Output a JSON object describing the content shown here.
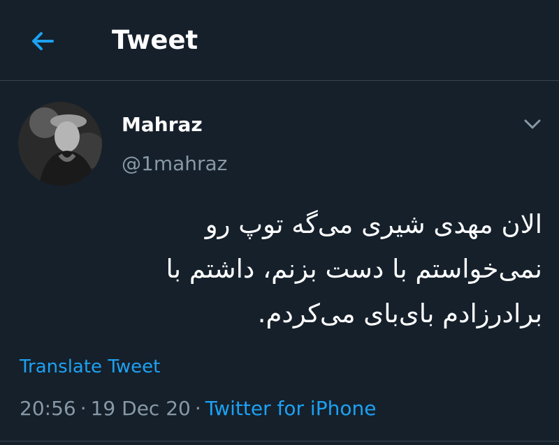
{
  "header": {
    "title": "Tweet",
    "back_icon": "arrow-left-icon"
  },
  "tweet": {
    "author": {
      "display_name": "Mahraz",
      "handle": "@1mahraz",
      "avatar_icon": "user-avatar"
    },
    "text_lines": [
      "الان مهدی شیری می‌گه توپ رو",
      "نمی‌خواستم با دست بزنم، داشتم با",
      "برادرزادم بای‌بای می‌کردم."
    ],
    "translate_label": "Translate Tweet",
    "time": "20:56",
    "date": "19 Dec 20",
    "separator": "·",
    "source": "Twitter for iPhone"
  },
  "colors": {
    "background": "#15202b",
    "accent": "#1da1f2",
    "secondary_text": "#8899a6",
    "divider": "#38444d"
  }
}
